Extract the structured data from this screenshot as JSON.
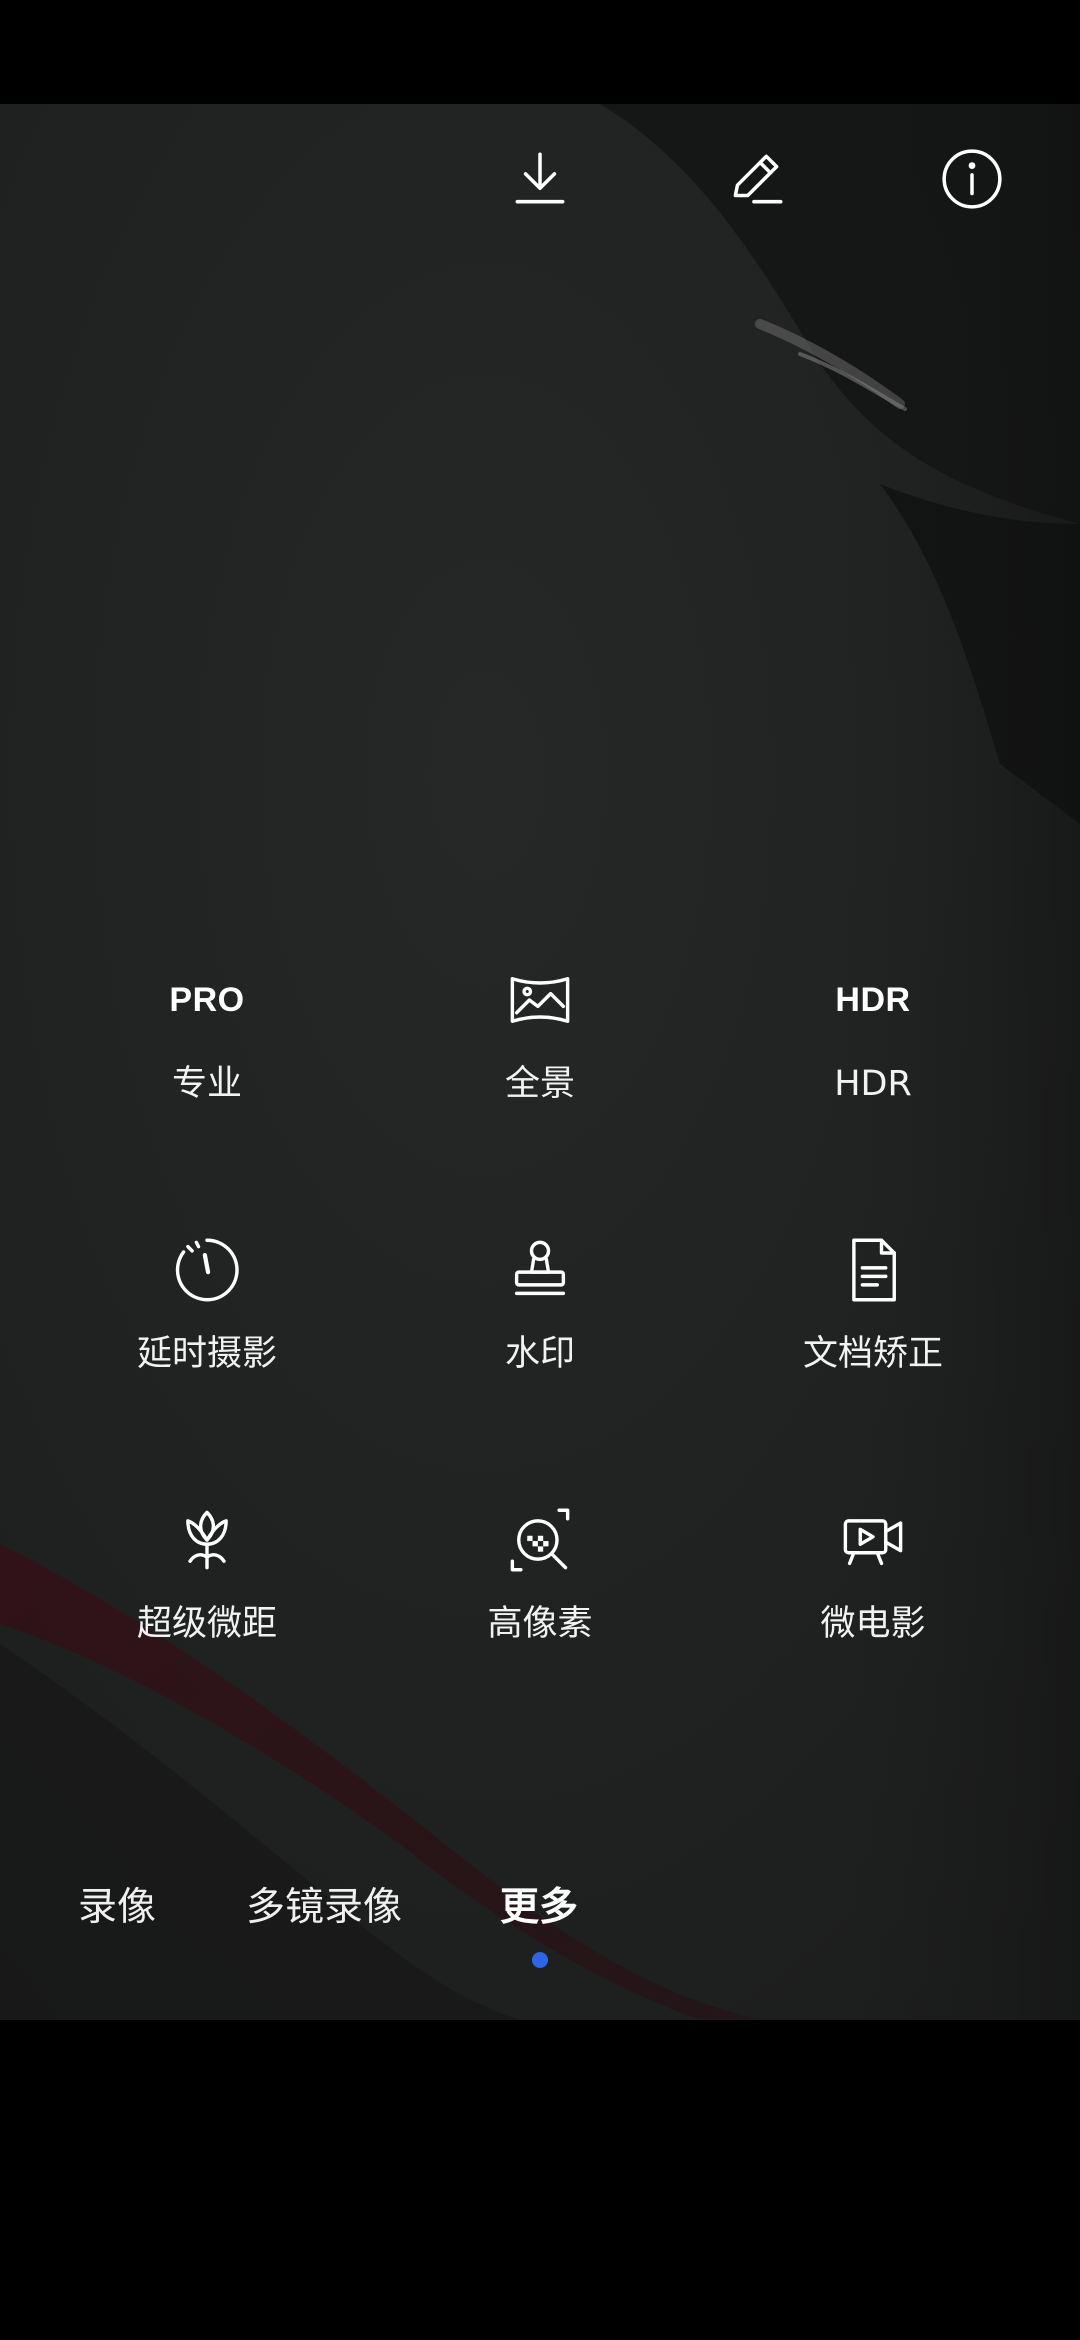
{
  "top_bar": {
    "icons": [
      "download-icon",
      "edit-icon",
      "info-icon"
    ]
  },
  "mode_grid": {
    "items": [
      {
        "icon": "PRO",
        "label": "专业"
      },
      {
        "icon": "panorama-icon",
        "label": "全景"
      },
      {
        "icon": "HDR",
        "label": "HDR"
      },
      {
        "icon": "timelapse-icon",
        "label": "延时摄影"
      },
      {
        "icon": "watermark-stamp-icon",
        "label": "水印"
      },
      {
        "icon": "document-icon",
        "label": "文档矫正"
      },
      {
        "icon": "macro-flower-icon",
        "label": "超级微距"
      },
      {
        "icon": "high-res-icon",
        "label": "高像素"
      },
      {
        "icon": "movie-camera-icon",
        "label": "微电影"
      }
    ]
  },
  "mode_tabs": {
    "items": [
      "录像",
      "多镜录像",
      "更多"
    ],
    "active": "更多",
    "indicator_color": "#2f66e6"
  }
}
